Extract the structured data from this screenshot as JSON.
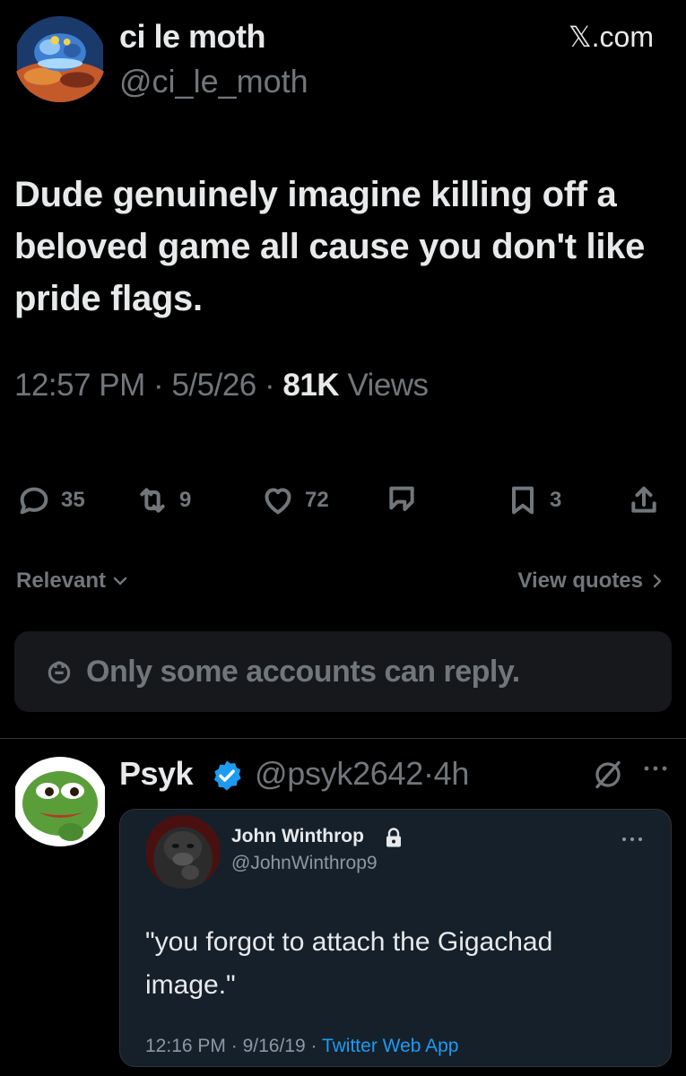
{
  "tweet": {
    "display_name": "ci le moth",
    "handle": "@ci_le_moth",
    "source": "𝕏.com",
    "text": "Dude genuinely imagine killing off a beloved game all cause you don't like pride flags.",
    "time": "12:57 PM",
    "date": "5/5/26",
    "views_count": "81K",
    "views_label": "Views",
    "separator": "·"
  },
  "actions": {
    "replies": "35",
    "reposts": "9",
    "likes": "72",
    "bookmarks": "3"
  },
  "controls": {
    "sort_label": "Relevant",
    "view_quotes_label": "View quotes",
    "reply_restriction": "Only some accounts can reply."
  },
  "reply": {
    "display_name": "Psyk",
    "handle": "@psyk2642",
    "separator": "·",
    "age": "4h",
    "quote": {
      "display_name": "John Winthrop",
      "handle": "@JohnWinthrop9",
      "text": "\"you forgot to attach the Gigachad image.\"",
      "time": "12:16 PM",
      "date": "9/16/19",
      "app": "Twitter Web App",
      "separator": "·"
    }
  },
  "colors": {
    "background": "#000000",
    "text_primary": "#e7e9ea",
    "text_secondary": "#71767b",
    "accent_blue": "#1d9bf0",
    "quote_background": "#15202b"
  },
  "icons": {
    "author_avatar": "moth-avatar-icon",
    "reply": "reply-bubble-icon",
    "repost": "repost-icon",
    "like": "heart-icon",
    "grok": "grok-icon",
    "bookmark": "bookmark-icon",
    "share": "share-icon",
    "sort": "chevron-down-icon",
    "view_quotes": "chevron-right-icon",
    "restriction": "lock-icon",
    "verified": "verified-badge-icon",
    "more": "more-dots-icon"
  }
}
